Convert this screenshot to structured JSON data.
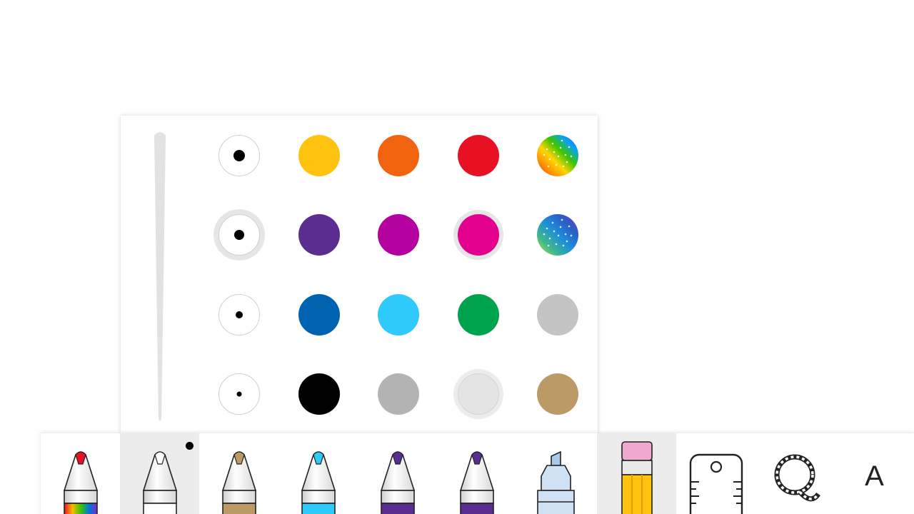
{
  "panel": {
    "size_options": [
      {
        "name": "size-xlarge",
        "selected": false
      },
      {
        "name": "size-large",
        "selected": true
      },
      {
        "name": "size-medium",
        "selected": false
      },
      {
        "name": "size-small",
        "selected": false
      }
    ],
    "colors": [
      [
        "#ffc20e",
        "#f26310",
        "#e81123",
        "rainbow-glitter"
      ],
      [
        "#5c2d91",
        "#b4009e",
        "#e3008c",
        "ocean-glitter"
      ],
      [
        "#0063b1",
        "#2ecafb",
        "#00a34d",
        "#c4c4c4"
      ],
      [
        "#000000",
        "#b3b3b3",
        "#e4e4e4",
        "#bb9a68"
      ]
    ],
    "selected_color": "#e3008c"
  },
  "toolbar": {
    "tools": [
      {
        "name": "rainbow-pen-tool",
        "tip": "#e81123",
        "body": "rainbow"
      },
      {
        "name": "white-pen-tool",
        "tip": "#ffffff",
        "body": "#ffffff",
        "active": true
      },
      {
        "name": "gold-pen-tool",
        "tip": "#bb9a68",
        "body": "#bb9a68"
      },
      {
        "name": "cyan-pen-tool",
        "tip": "#2ecafb",
        "body": "#2ecafb"
      },
      {
        "name": "purple-pen-tool-1",
        "tip": "#5c2d91",
        "body": "#5c2d91"
      },
      {
        "name": "purple-pen-tool-2",
        "tip": "#5c2d91",
        "body": "#5c2d91"
      },
      {
        "name": "highlighter-tool",
        "tip": "#a7c9ea",
        "body": "#cfe2f3"
      },
      {
        "name": "eraser-tool"
      },
      {
        "name": "ruler-tool"
      },
      {
        "name": "lasso-select-tool"
      },
      {
        "name": "text-tool",
        "label": "A"
      }
    ]
  }
}
